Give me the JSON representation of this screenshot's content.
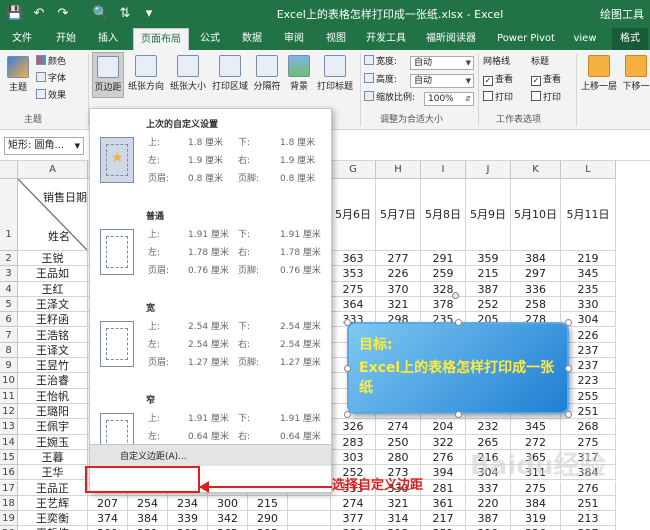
{
  "titlebar": {
    "title": "Excel上的表格怎样打印成一张纸.xlsx  -  Excel",
    "right": "绘图工具",
    "qa_save_icon": "save-icon",
    "qa_undo_icon": "undo-icon",
    "qa_redo_icon": "redo-icon",
    "qa_preview_icon": "print-preview-icon",
    "qa_sort_icon": "sort-icon"
  },
  "tabs": [
    "文件",
    "开始",
    "插入",
    "页面布局",
    "公式",
    "数据",
    "审阅",
    "视图",
    "开发工具",
    "福昕阅读器",
    "Power Pivot",
    "view",
    "格式"
  ],
  "active_tab": "页面布局",
  "ribbon": {
    "theme_group": {
      "themes": "主题",
      "colors": "颜色",
      "fonts": "字体",
      "effects": "效果",
      "label": "主题"
    },
    "page_setup": {
      "margins": "页边距",
      "orientation": "纸张方向",
      "size": "纸张大小",
      "print_area": "打印区域",
      "breaks": "分隔符",
      "background": "背景",
      "print_titles": "打印标题"
    },
    "scale": {
      "width_label": "宽度:",
      "width_value": "自动",
      "height_label": "高度:",
      "height_value": "自动",
      "scale_label": "缩放比例:",
      "scale_value": "100%",
      "label": "调整为合适大小"
    },
    "sheet_options": {
      "gridlines": "网格线",
      "headings": "标题",
      "view1": "查看",
      "print1": "打印",
      "view2": "查看",
      "print2": "打印",
      "label": "工作表选项"
    },
    "arrange": {
      "bring_forward": "上移一层",
      "send_backward": "下移一"
    }
  },
  "namebox": "矩形: 圆角...",
  "dropdown": {
    "options": [
      {
        "name": "上次的自定义设置",
        "top": "1.8 厘米",
        "bottom": "1.8 厘米",
        "left": "1.9 厘米",
        "right": "1.9 厘米",
        "header": "0.8 厘米",
        "footer": "0.8 厘米"
      },
      {
        "name": "普通",
        "top": "1.91 厘米",
        "bottom": "1.91 厘米",
        "left": "1.78 厘米",
        "right": "1.78 厘米",
        "header": "0.76 厘米",
        "footer": "0.76 厘米"
      },
      {
        "name": "宽",
        "top": "2.54 厘米",
        "bottom": "2.54 厘米",
        "left": "2.54 厘米",
        "right": "2.54 厘米",
        "header": "1.27 厘米",
        "footer": "1.27 厘米"
      },
      {
        "name": "窄",
        "top": "1.91 厘米",
        "bottom": "1.91 厘米",
        "left": "0.64 厘米",
        "right": "0.64 厘米",
        "header": "0.76 厘米",
        "footer": "0.76 厘米"
      }
    ],
    "labels": {
      "top": "上:",
      "bottom": "下:",
      "left": "左:",
      "right": "右:",
      "header": "页眉:",
      "footer": "页脚:"
    },
    "custom": "自定义边距(A)..."
  },
  "grid": {
    "columns": [
      "A",
      "G",
      "H",
      "I",
      "J",
      "K",
      "L"
    ],
    "header_row": {
      "a_top": "销售日期",
      "a_bottom": "姓名",
      "dates": [
        "5月6日",
        "5月7日",
        "5月8日",
        "5月9日",
        "5月10日",
        "5月11日"
      ]
    },
    "row_numbers": [
      "1",
      "2",
      "3",
      "4",
      "5",
      "6",
      "7",
      "8",
      "9",
      "10",
      "11",
      "12",
      "13",
      "14",
      "15",
      "16",
      "17",
      "18",
      "19",
      "20"
    ],
    "names": [
      "王锐",
      "王品如",
      "王红",
      "王泽文",
      "王籽函",
      "王浩铭",
      "王译文",
      "王昱竹",
      "王治睿",
      "王怡帆",
      "王璐阳",
      "王佩宇",
      "王婉玉",
      "王暮",
      "王华",
      "王品正",
      "王艺辉",
      "王奕衡",
      "王哲栋"
    ],
    "data": [
      [
        "363",
        "277",
        "291",
        "359",
        "384",
        "219"
      ],
      [
        "353",
        "226",
        "259",
        "215",
        "297",
        "345"
      ],
      [
        "275",
        "370",
        "328",
        "387",
        "336",
        "235"
      ],
      [
        "364",
        "321",
        "378",
        "252",
        "258",
        "330"
      ],
      [
        "333",
        "298",
        "235",
        "205",
        "278",
        "304"
      ],
      [
        "",
        "",
        "",
        "",
        "",
        "226"
      ],
      [
        "",
        "",
        "",
        "",
        "",
        "237"
      ],
      [
        "",
        "",
        "",
        "",
        "",
        "237"
      ],
      [
        "",
        "",
        "",
        "",
        "",
        "223"
      ],
      [
        "",
        "",
        "",
        "",
        "",
        "255"
      ],
      [
        "",
        "",
        "",
        "",
        "",
        "251"
      ],
      [
        "326",
        "274",
        "204",
        "232",
        "345",
        "268"
      ],
      [
        "283",
        "250",
        "322",
        "265",
        "272",
        "275"
      ],
      [
        "303",
        "280",
        "276",
        "216",
        "365",
        "317"
      ],
      [
        "252",
        "273",
        "394",
        "304",
        "311",
        "384"
      ],
      [
        "333",
        "330",
        "281",
        "337",
        "275",
        "276"
      ],
      [
        "274",
        "321",
        "361",
        "220",
        "384",
        "251"
      ],
      [
        "377",
        "314",
        "217",
        "387",
        "319",
        "213"
      ],
      [
        "386",
        "213",
        "351",
        "219",
        "226",
        "397"
      ]
    ],
    "left_extra": [
      [
        "",
        "",
        "",
        "",
        ""
      ],
      [
        "",
        "",
        "",
        "",
        ""
      ],
      [
        "",
        "",
        "",
        "",
        ""
      ],
      [
        "",
        "",
        "",
        "",
        ""
      ],
      [
        "",
        "",
        "",
        "",
        ""
      ],
      [
        "",
        "",
        "",
        "",
        ""
      ],
      [
        "",
        "",
        "",
        "",
        ""
      ],
      [
        "",
        "",
        "",
        "",
        ""
      ],
      [
        "",
        "",
        "",
        "",
        ""
      ],
      [
        "",
        "",
        "",
        "",
        ""
      ],
      [
        "",
        "",
        "",
        "",
        ""
      ],
      [
        "",
        "",
        "",
        "",
        ""
      ],
      [
        "",
        "",
        "",
        "",
        ""
      ],
      [
        "",
        "",
        "",
        "",
        ""
      ],
      [
        "",
        "",
        "",
        "",
        ""
      ],
      [
        "",
        "",
        "",
        "",
        ""
      ],
      [
        "207",
        "254",
        "234",
        "300",
        "215"
      ],
      [
        "374",
        "384",
        "339",
        "342",
        "290"
      ],
      [
        "309",
        "331",
        "203",
        "362",
        "293"
      ]
    ]
  },
  "callout": {
    "title": "目标:",
    "body": "Excel上的表格怎样打印成一张纸"
  },
  "annotation": "选择自定义边距",
  "watermark": "Baidu经验"
}
